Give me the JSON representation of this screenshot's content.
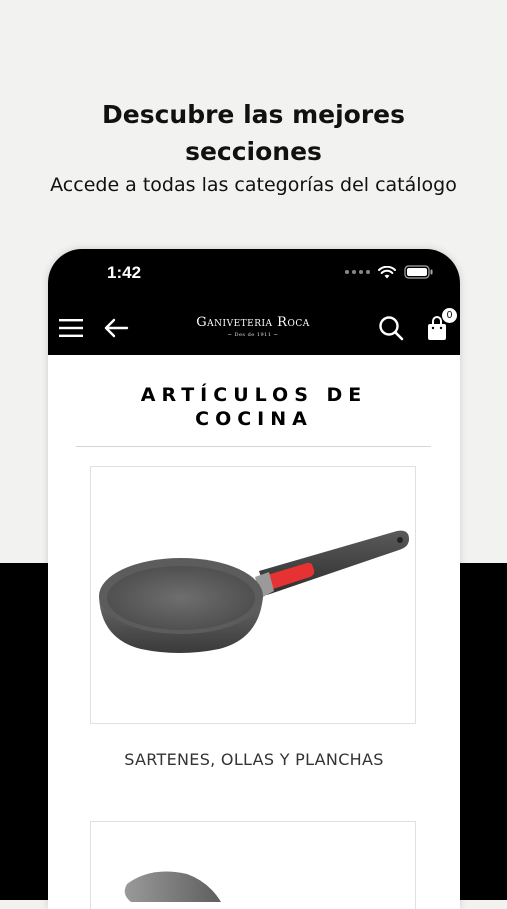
{
  "promo": {
    "headline_line1": "Descubre las mejores",
    "headline_line2": "secciones",
    "subheadline": "Accede a todas las categorías del catálogo"
  },
  "status_bar": {
    "time": "1:42"
  },
  "header": {
    "logo_text": "Ganiveteria Roca",
    "logo_tagline": "~ Des de 1911 ~",
    "cart_count": "0",
    "icons": [
      "menu-icon",
      "back-arrow-icon",
      "search-icon",
      "shopping-bag-icon"
    ]
  },
  "category": {
    "title_line1": "ARTÍCULOS DE",
    "title_line2": "COCINA"
  },
  "items": [
    {
      "label": "SARTENES, OLLAS Y PLANCHAS",
      "image": "frying-pan-image"
    },
    {
      "label": "",
      "image": "knife-image"
    }
  ],
  "colors": {
    "background": "#f2f2f0",
    "band": "#000000",
    "accent_red": "#e63232"
  }
}
